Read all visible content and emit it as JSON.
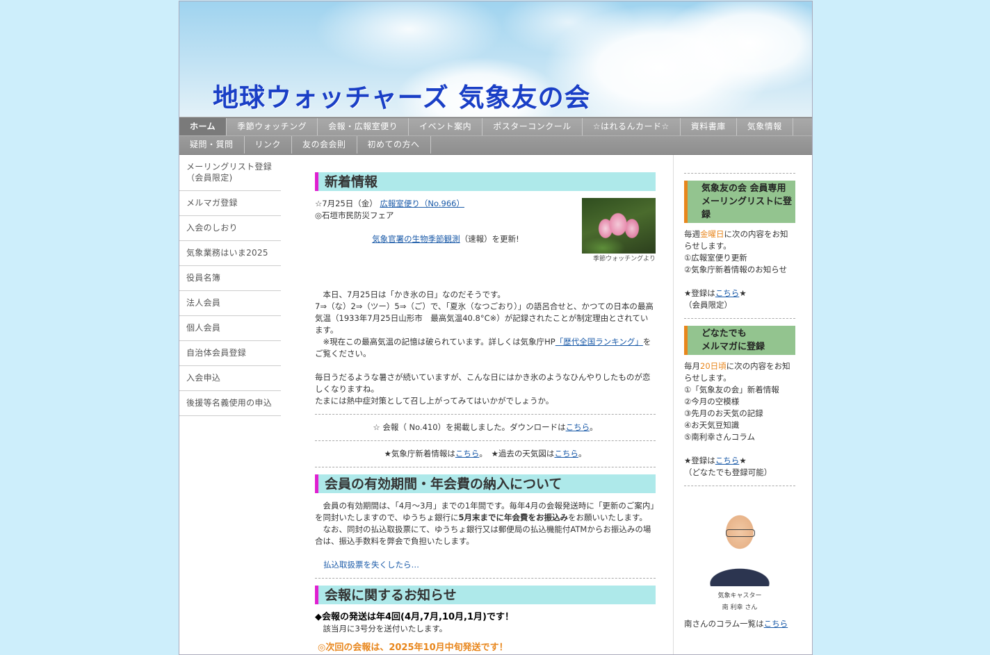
{
  "site_title": "地球ウォッチャーズ 気象友の会",
  "gnav_row1": [
    "ホーム",
    "季節ウォッチング",
    "会報・広報室便り",
    "イベント案内",
    "ポスターコンクール",
    "☆はれるんカード☆",
    "資料書庫",
    "気象情報"
  ],
  "gnav_row2": [
    "疑問・質問",
    "リンク",
    "友の会会則",
    "初めての方へ"
  ],
  "left_nav": [
    "メーリングリスト登録　（会員限定)",
    "メルマガ登録",
    "入会のしおり",
    "気象業務はいま2025",
    "役員名簿",
    "法人会員",
    "個人会員",
    "自治体会員登録",
    "入会申込",
    "後援等名義使用の申込"
  ],
  "news": {
    "title": "新着情報",
    "date": "☆7月25日（金）",
    "date_link": "広報室便り（No.966）",
    "sub": "◎石垣市民防災フェア",
    "update_link": "気象官署の生物季節観測",
    "update_rest": "（速報）を更新!",
    "photo_caption": "季節ウォッチングより",
    "p1": "　本日、7月25日は「かき氷の日」なのだそうです。",
    "p2": "7⇒（な）2⇒（ツー）5⇒（ご）で、「夏氷（なつごおり）」の語呂合せと、かつての日本の最高気温（1933年7月25日山形市　最高気温40.8°C※）が記録されたことが制定理由とされています。",
    "p3": "　※現在この最高気温の記憶は破られています。詳しくは気象庁HP",
    "p3_link": "「歴代全国ランキング」",
    "p3_rest": "をご覧ください。",
    "p4": "毎日うだるような暑さが続いていますが、こんな日にはかき氷のようなひんやりしたものが恋しくなりますね。",
    "p5": "たまには熱中症対策として召し上がってみてはいかがでしょうか。",
    "kaiho": "☆ 会報（ No.410）を掲載しました。ダウンロードは",
    "kaiho_link": "こちら",
    "kaiho_end": "。",
    "jma": "★気象庁新着情報は",
    "jma_link": "こちら",
    "jma_mid": "。　★過去の天気図は",
    "jma_link2": "こちら",
    "jma_end": "。"
  },
  "membership": {
    "title": "会員の有効期間・年会費の納入について",
    "p1a": "　会員の有効期間は、「4月〜3月」までの1年間です。毎年4月の会報発送時に「更新のご案内」を同封いたしますので、ゆうちょ銀行に",
    "p1b": "5月末までに年会費をお振込み",
    "p1c": "をお願いいたします。",
    "p2": "　なお、同封の払込取扱票にて、ゆうちょ銀行又は郵便局の払込機能付ATMからお振込みの場合は、振込手数料を弊会で負担いたします。",
    "link": "払込取扱票を失くしたら…"
  },
  "kaiho_notice": {
    "title": "会報に関するお知らせ",
    "bold": "◆会報の発送は年4回(4月,7月,10月,1月)です！",
    "sub": "　該当月に3号分を送付いたします。",
    "next": "◎次回の会報は、2025年10月中旬発送です！"
  },
  "right": {
    "ml_title": "気象友の会 会員専用メーリングリストに登録",
    "ml_text_a": "毎週",
    "ml_text_day": "金曜日",
    "ml_text_b": "に次の内容をお知らせします。",
    "ml_items": [
      "①広報室便り更新",
      "②気象庁新着情報のお知らせ"
    ],
    "ml_reg": "★登録は",
    "ml_reg_link": "こちら",
    "ml_reg_end": "★",
    "ml_note": "（会員限定）",
    "mm_title1": "どなたでも",
    "mm_title2": "メルマガに登録",
    "mm_text_a": "毎月",
    "mm_text_day": "20日頃",
    "mm_text_b": "に次の内容をお知らせします。",
    "mm_items": [
      "①「気象友の会」新着情報",
      "②今月の空模様",
      "③先月のお天気の記録",
      "④お天気豆知識",
      "⑤南利幸さんコラム"
    ],
    "mm_reg": "★登録は",
    "mm_reg_link": "こちら",
    "mm_reg_end": "★",
    "mm_note": "（どなたでも登録可能）",
    "prof_role": "気象キャスター",
    "prof_name": "南 利幸 さん",
    "column": "南さんのコラム一覧は",
    "column_link": "こちら"
  },
  "colors": {
    "accent_title": "#1a3fc6",
    "heading_bg": "#aee9ea",
    "heading_bar": "#e020d0",
    "side_bg": "#93c48f",
    "side_bar": "#e8861c"
  }
}
